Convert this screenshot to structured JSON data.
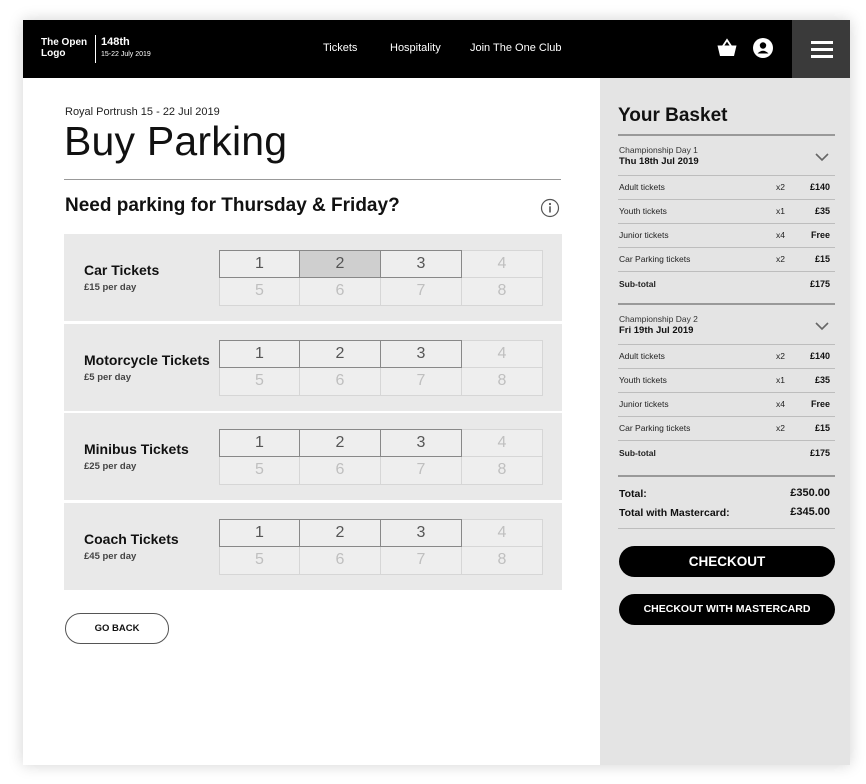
{
  "header": {
    "logo": "The Open Logo",
    "logo_line1": "The Open",
    "logo_line2": "Logo",
    "event_number": "148th",
    "event_dates": "15-22 July 2019",
    "nav": [
      "Tickets",
      "Hospitality",
      "Join The One Club"
    ],
    "icons": [
      "basket-icon",
      "account-icon",
      "menu-icon"
    ]
  },
  "main": {
    "venue": "Royal Portrush 15 - 22 Jul 2019",
    "title": "Buy Parking",
    "question": "Need parking for Thursday & Friday?",
    "ticket_types": [
      {
        "name": "Car Tickets",
        "price": "£15 per day",
        "selected": "2"
      },
      {
        "name": "Motorcycle Tickets",
        "price": "£5 per day",
        "selected": null
      },
      {
        "name": "Minibus Tickets",
        "price": "£25 per day",
        "selected": null
      },
      {
        "name": "Coach Tickets",
        "price": "£45 per day",
        "selected": null
      }
    ],
    "quantities": [
      "1",
      "2",
      "3",
      "4",
      "5",
      "6",
      "7",
      "8"
    ],
    "available_quantities": [
      "1",
      "2",
      "3"
    ],
    "go_back": "GO BACK"
  },
  "basket": {
    "title": "Your Basket",
    "days": [
      {
        "label": "Championship Day 1",
        "date": "Thu 18th Jul 2019",
        "lines": [
          {
            "name": "Adult tickets",
            "qty": "x2",
            "amount": "£140"
          },
          {
            "name": "Youth tickets",
            "qty": "x1",
            "amount": "£35"
          },
          {
            "name": "Junior tickets",
            "qty": "x4",
            "amount": "Free"
          },
          {
            "name": "Car Parking tickets",
            "qty": "x2",
            "amount": "£15"
          }
        ],
        "subtotal_label": "Sub-total",
        "subtotal": "£175"
      },
      {
        "label": "Championship Day 2",
        "date": "Fri 19th Jul 2019",
        "lines": [
          {
            "name": "Adult tickets",
            "qty": "x2",
            "amount": "£140"
          },
          {
            "name": "Youth tickets",
            "qty": "x1",
            "amount": "£35"
          },
          {
            "name": "Junior tickets",
            "qty": "x4",
            "amount": "Free"
          },
          {
            "name": "Car Parking tickets",
            "qty": "x2",
            "amount": "£15"
          }
        ],
        "subtotal_label": "Sub-total",
        "subtotal": "£175"
      }
    ],
    "total_label": "Total:",
    "total": "£350.00",
    "total_mc_label": "Total with Mastercard:",
    "total_mc": "£345.00",
    "checkout": "CHECKOUT",
    "checkout_mc": "CHECKOUT WITH MASTERCARD"
  },
  "colors": {
    "header_bg": "#000000",
    "menu_bg": "#3a3a3a",
    "basket_bg": "#e4e4e4",
    "row_bg": "#e9e9e9",
    "selected_cell": "#cfcfcf"
  }
}
